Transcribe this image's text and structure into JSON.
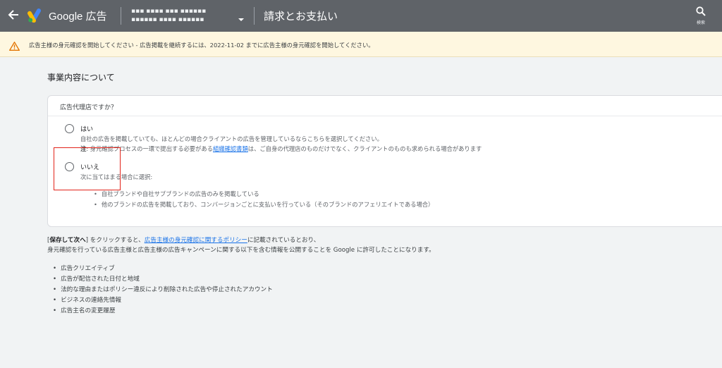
{
  "topbar": {
    "brand": "Google 広告",
    "account_line1": "▪▪▪ ▪▪▪▪ ▪▪▪ ▪▪▪▪▪▪",
    "account_line2": "▪▪▪▪▪▪ ▪▪▪▪ ▪▪▪▪▪▪",
    "page_title": "請求とお支払い",
    "search_label": "検索"
  },
  "banner": {
    "text": "広告主様の身元確認を開始してください - 広告掲載を継続するには、2022-11-02 までに広告主様の身元確認を開始してください。"
  },
  "section": {
    "title": "事業内容について"
  },
  "card": {
    "question": "広告代理店ですか？",
    "yes": {
      "label": "はい",
      "desc1": "自社の広告を掲載していても、ほとんどの場合クライアントの広告を管理しているならこちらを選択してください。",
      "note_label": "注",
      "note_pre": ": 身元確認プロセスの一環で提出する必要がある",
      "note_link": "組織確認書類",
      "note_post": "は、ご自身の代理店のものだけでなく、クライアントのものも求められる場合があります"
    },
    "no": {
      "label": "いいえ",
      "desc": "次に当てはまる場合に選択:",
      "bullets": [
        "自社ブランドや自社サブブランドの広告のみを掲載している",
        "他のブランドの広告を掲載しており、コンバージョンごとに支払いを行っている（そのブランドのアフェリエイトである場合）"
      ]
    }
  },
  "policy": {
    "bracket_open": "[",
    "save_next": "保存して次へ",
    "bracket_close": "]",
    "part1": " をクリックすると、",
    "link": "広告主様の身元確認に関するポリシー",
    "part2": "に記載されているとおり、",
    "line2": "身元確認を行っている広告主様と広告主様の広告キャンペーンに関する以下を含む情報を公開することを Google に許可したことになります。"
  },
  "info_list": [
    "広告クリエイティブ",
    "広告が配信された日付と地域",
    "法的な理由またはポリシー違反により削除された広告や停止されたアカウント",
    "ビジネスの連絡先情報",
    "広告主名の変更履歴"
  ],
  "colors": {
    "topbar": "#5f6368",
    "banner": "#fef7e0",
    "warning": "#e37400",
    "link": "#1a73e8",
    "highlight": "#e2231a"
  }
}
